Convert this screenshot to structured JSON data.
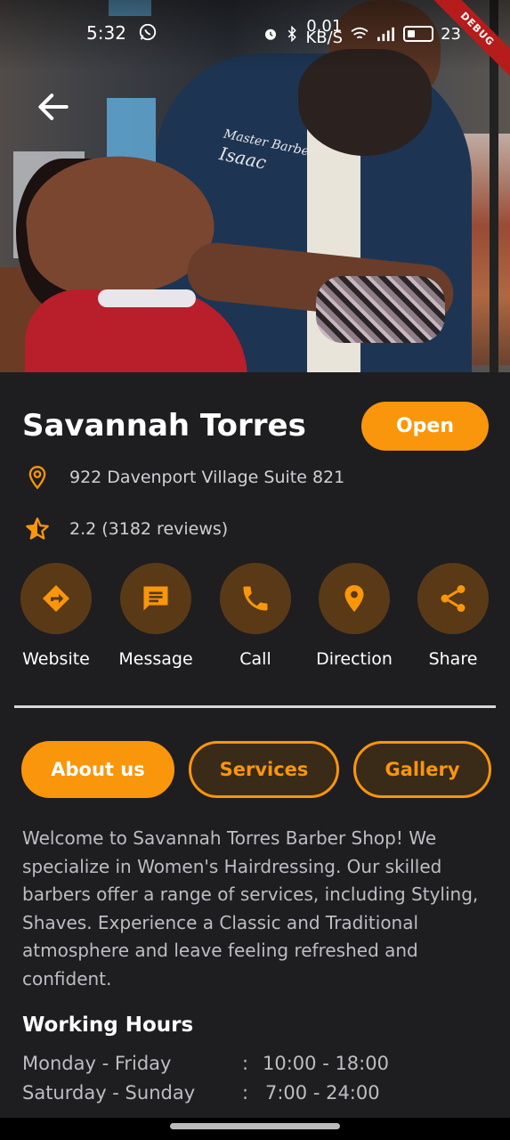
{
  "status_bar": {
    "time": "5:32",
    "network_speed": "0.01",
    "network_unit": "KB/S",
    "battery_percent": "23",
    "debug_banner": "DEBUG"
  },
  "shop": {
    "name": "Savannah Torres",
    "status": "Open",
    "address": "922 Davenport Village Suite 821",
    "rating": "2.2 (3182 reviews)"
  },
  "hero": {
    "embroidery_line1": "Master Barber",
    "embroidery_line2": "Isaac"
  },
  "actions": [
    {
      "label": "Website",
      "icon": "directions-arrow-icon"
    },
    {
      "label": "Message",
      "icon": "message-icon"
    },
    {
      "label": "Call",
      "icon": "phone-icon"
    },
    {
      "label": "Direction",
      "icon": "map-pin-icon"
    },
    {
      "label": "Share",
      "icon": "share-icon"
    }
  ],
  "tabs": [
    {
      "label": "About us",
      "active": true
    },
    {
      "label": "Services",
      "active": false
    },
    {
      "label": "Gallery",
      "active": false
    }
  ],
  "about_text": "Welcome to Savannah Torres Barber Shop! We specialize in Women's Hairdressing. Our skilled barbers offer a range of services, including Styling, Shaves. Experience a Classic and Traditional atmosphere and leave feeling refreshed and confident.",
  "working_hours": {
    "title": "Working Hours",
    "rows": [
      {
        "day": "Monday - Friday",
        "separator": ":",
        "time": "10:00 - 18:00"
      },
      {
        "day": "Saturday - Sunday",
        "separator": ":",
        "time": "7:00 - 24:00"
      }
    ]
  },
  "colors": {
    "accent": "#f9960b",
    "background": "#1e1e21",
    "action_circle": "#5a3a16"
  }
}
